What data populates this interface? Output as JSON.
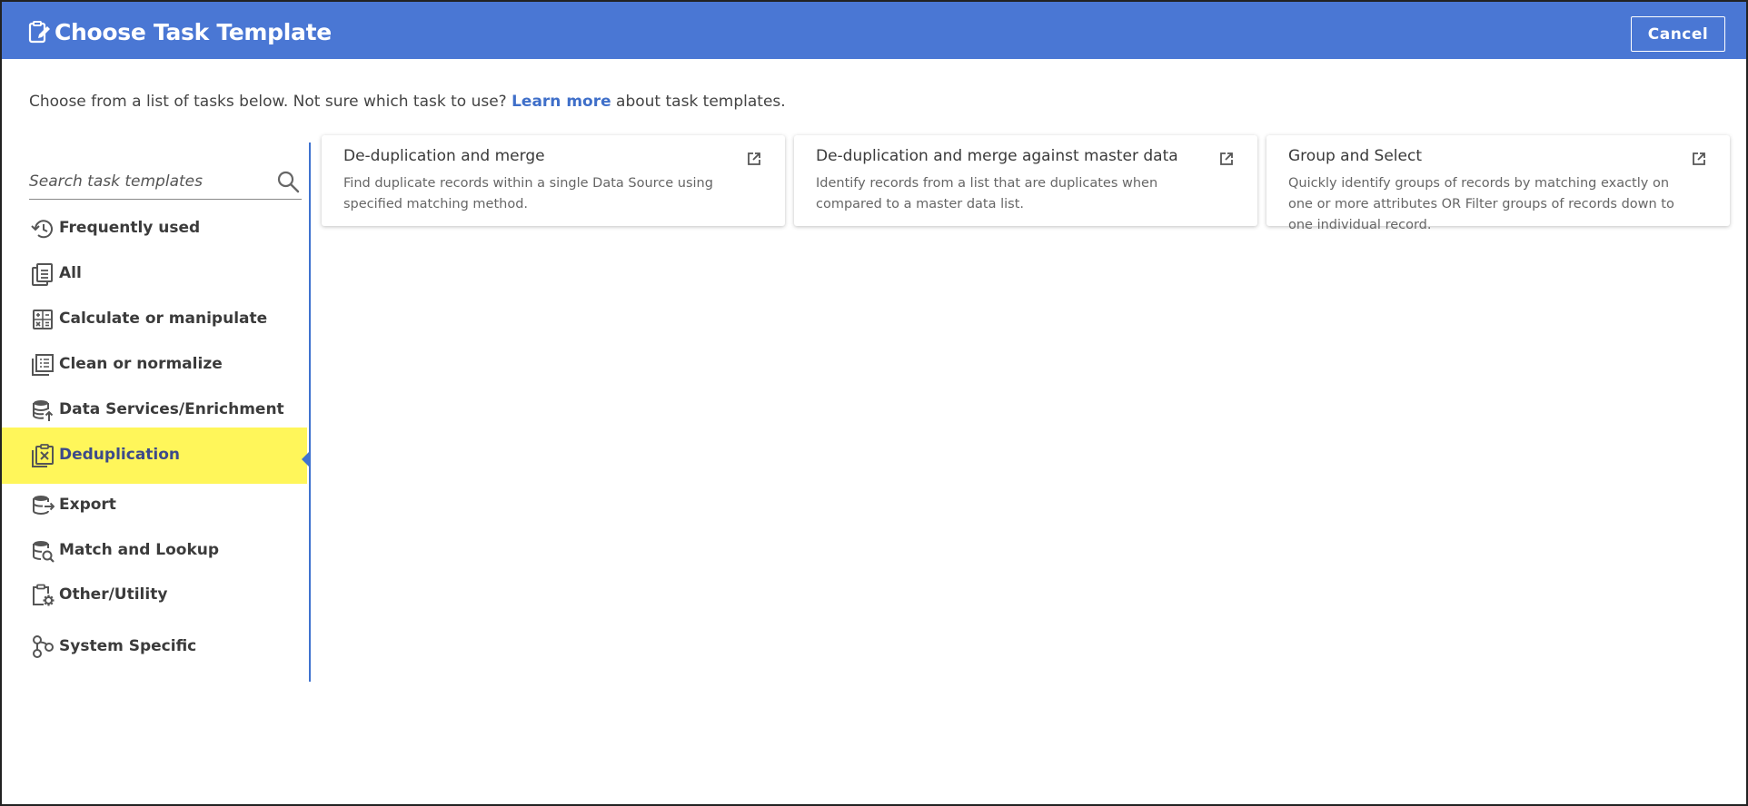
{
  "header": {
    "title": "Choose Task Template",
    "title_icon": "clipboard-edit-icon",
    "cancel_label": "Cancel",
    "background_color": "#4a77d4"
  },
  "intro": {
    "prefix": "Choose from a list of tasks below. Not sure which task to use? ",
    "link_label": "Learn more",
    "suffix": " about task templates."
  },
  "search": {
    "placeholder": "Search task templates",
    "value": "",
    "icon": "search-icon"
  },
  "sidebar": {
    "active_color": "#fff65a",
    "items": [
      {
        "label": "Frequently used",
        "icon": "history-icon",
        "active": false
      },
      {
        "label": "All",
        "icon": "clipboard-list-icon",
        "active": false
      },
      {
        "label": "Calculate or manipulate",
        "icon": "calculator-icon",
        "active": false
      },
      {
        "label": "Clean or normalize",
        "icon": "grid-stack-icon",
        "active": false
      },
      {
        "label": "Data Services/Enrichment",
        "icon": "database-upload-icon",
        "active": false
      },
      {
        "label": "Deduplication",
        "icon": "clipboard-x-icon",
        "active": true
      },
      {
        "label": "Export",
        "icon": "database-export-icon",
        "active": false
      },
      {
        "label": "Match and Lookup",
        "icon": "database-search-icon",
        "active": false
      },
      {
        "label": "Other/Utility",
        "icon": "clipboard-gear-icon",
        "active": false
      },
      {
        "label": "System Specific",
        "icon": "nodes-icon",
        "active": false
      }
    ]
  },
  "cards": [
    {
      "title": "De-duplication and merge",
      "description": "Find duplicate records within a single Data Source using specified matching method.",
      "icon": "open-external-icon"
    },
    {
      "title": "De-duplication and merge against master data",
      "description": "Identify records from a list that are duplicates when compared to a master data list.",
      "icon": "open-external-icon"
    },
    {
      "title": "Group and Select",
      "description": "Quickly identify groups of records by matching exactly on one or more attributes OR Filter groups of records down to one individual record.",
      "icon": "open-external-icon"
    }
  ]
}
